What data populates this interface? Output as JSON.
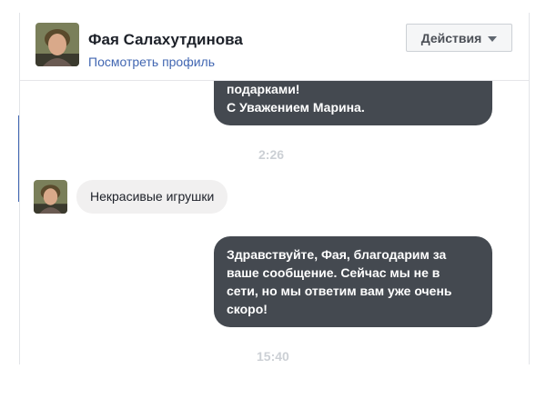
{
  "header": {
    "contact_name": "Фая Салахутдинова",
    "profile_link": "Посмотреть профиль",
    "actions_label": "Действия"
  },
  "messages": [
    {
      "direction": "outgoing",
      "lines": [
        "подарками!",
        "С Уважением Марина."
      ]
    },
    {
      "direction": "timestamp",
      "text": "2:26"
    },
    {
      "direction": "incoming",
      "text": "Некрасивые игрушки"
    },
    {
      "direction": "outgoing",
      "lines": [
        "Здравствуйте, Фая, благодарим за",
        "ваше сообщение. Сейчас мы не в",
        "сети, но мы ответим вам уже очень",
        "скоро!"
      ]
    },
    {
      "direction": "timestamp",
      "text": "15:40"
    }
  ],
  "colors": {
    "outgoing_bubble": "#444950",
    "incoming_bubble": "#f1f0f0",
    "link": "#4267b2",
    "timestamp": "#ccd0d5"
  },
  "icons": {
    "actions_caret": "chevron-down-icon"
  }
}
